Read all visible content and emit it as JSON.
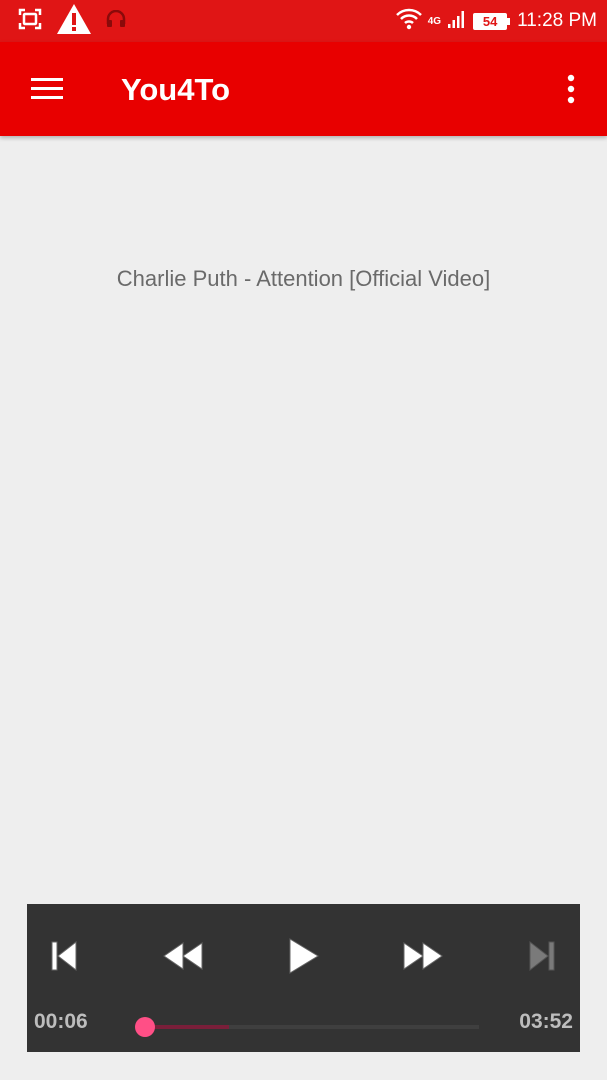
{
  "status_bar": {
    "icons_left": [
      "screenshot-icon",
      "warning-icon",
      "headphones-icon"
    ],
    "network": "4G",
    "battery": "54",
    "time": "11:28 PM"
  },
  "app_bar": {
    "title": "You4To",
    "menu_icon": "hamburger-menu-icon",
    "overflow_icon": "more-vert-icon",
    "color": "#e80000"
  },
  "main": {
    "video_title": "Charlie Puth - Attention [Official Video]"
  },
  "player": {
    "elapsed": "00:06",
    "total": "03:52",
    "progress": 0.026,
    "buffered": 0.27,
    "controls": [
      "skip-previous-icon",
      "rewind-icon",
      "play-icon",
      "fast-forward-icon",
      "skip-next-icon"
    ],
    "accent": "#ff4f86"
  }
}
